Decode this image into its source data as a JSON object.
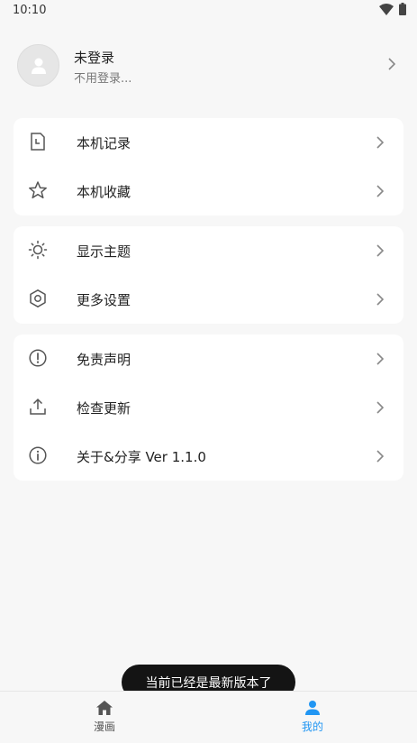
{
  "status_bar": {
    "time": "10:10",
    "wifi_icon": "wifi-icon",
    "battery_icon": "battery-icon"
  },
  "profile": {
    "name": "未登录",
    "subtitle": "不用登录...",
    "icon": "user-icon"
  },
  "groups": [
    [
      {
        "label": "本机记录",
        "icon": "history-file-icon"
      },
      {
        "label": "本机收藏",
        "icon": "star-icon"
      }
    ],
    [
      {
        "label": "显示主题",
        "icon": "brightness-icon"
      },
      {
        "label": "更多设置",
        "icon": "settings-hexagon-icon"
      }
    ],
    [
      {
        "label": "免责声明",
        "icon": "alert-circle-icon"
      },
      {
        "label": "检查更新",
        "icon": "upload-icon"
      },
      {
        "label": "关于&分享 Ver 1.1.0",
        "icon": "info-icon"
      }
    ]
  ],
  "toast": {
    "text": "当前已经是最新版本了"
  },
  "bottom_nav": {
    "items": [
      {
        "label": "漫画",
        "icon": "home-icon",
        "active": false
      },
      {
        "label": "我的",
        "icon": "person-icon",
        "active": true
      }
    ]
  },
  "colors": {
    "accent": "#2196f3",
    "background": "#f7f7f7",
    "card": "#ffffff",
    "toast": "#141414"
  }
}
